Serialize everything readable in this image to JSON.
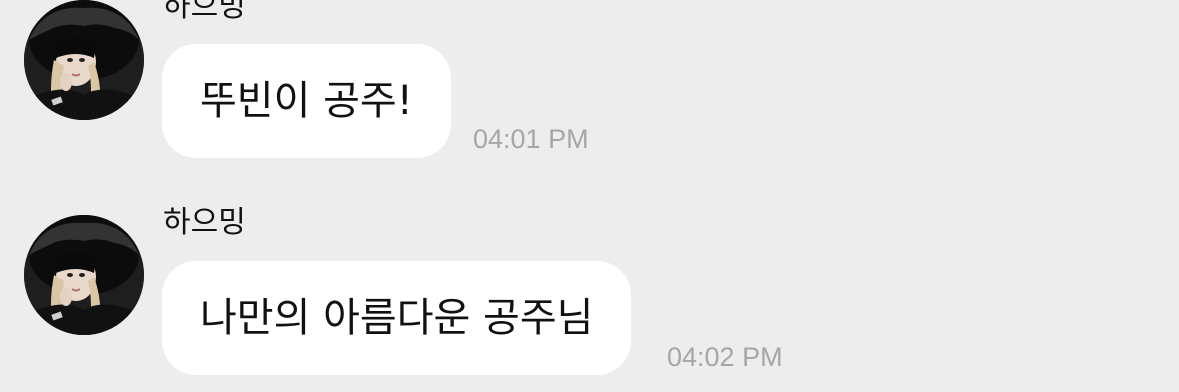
{
  "messages": [
    {
      "sender": "하으밍",
      "text": "뚜빈이 공주!",
      "time": "04:01 PM",
      "avatar_icon": "profile-photo"
    },
    {
      "sender": "하으밍",
      "text": "나만의 아름다운 공주님",
      "time": "04:02 PM",
      "avatar_icon": "profile-photo"
    }
  ],
  "colors": {
    "background": "#ededed",
    "bubble": "#ffffff",
    "time": "#a6a6a6",
    "text": "#111111"
  }
}
